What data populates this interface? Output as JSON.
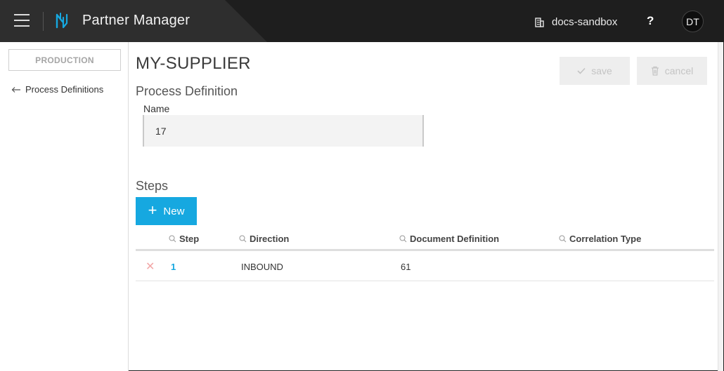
{
  "header": {
    "app_title": "Partner Manager",
    "tenant": "docs-sandbox",
    "help": "?",
    "user_initials": "DT",
    "icons": {
      "menu": "hamburger-icon",
      "logo": "partner-manager-logo",
      "tenant": "building-icon"
    }
  },
  "sidebar": {
    "environment": "PRODUCTION",
    "back_link": "Process Definitions"
  },
  "main": {
    "partner_name": "MY-SUPPLIER",
    "save_label": "save",
    "cancel_label": "cancel",
    "section_title": "Process Definition",
    "name_label": "Name",
    "name_value": "17",
    "steps_title": "Steps",
    "new_label": "New",
    "table": {
      "columns": [
        "Step",
        "Direction",
        "Document Definition",
        "Correlation Type"
      ],
      "rows": [
        {
          "step": "1",
          "direction": "INBOUND",
          "document_definition": "61",
          "correlation_type": ""
        }
      ]
    }
  },
  "colors": {
    "header_bg": "#1e1e1e",
    "accent": "#16a8e0",
    "delete_icon": "#f2a7a7",
    "disabled_button": "#eeeeee"
  }
}
